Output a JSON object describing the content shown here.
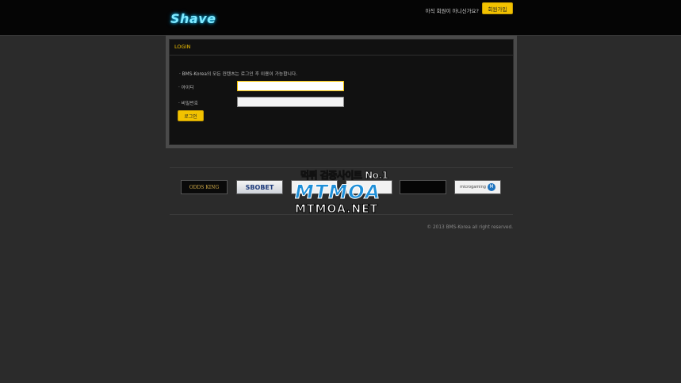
{
  "header": {
    "logo_text": "Shave",
    "signup_prompt": "아직 회원이 아니신가요?",
    "signup_button": "회원가입"
  },
  "login": {
    "title": "LOGIN",
    "notice": "· BMS-Korea의 모든 컨텐츠는 로그인 후 이용이 가능합니다.",
    "id_label": "· 아이디",
    "password_label": "· 비밀번호",
    "id_value": "",
    "password_value": "",
    "button": "로그인"
  },
  "partners": [
    "ODDS KING",
    "SBOBET",
    "",
    "",
    "",
    "microgaming"
  ],
  "watermark": {
    "top": "먹튀 검증사이트 No.1",
    "mid": "MTMOA",
    "bottom": "MTMOA.NET"
  },
  "footer": {
    "copyright": "© 2013 BMS-Korea all right reserved."
  },
  "colors": {
    "accent": "#f2c200",
    "background": "#2b2b2b",
    "topbar": "#050505",
    "panel": "#111111"
  }
}
